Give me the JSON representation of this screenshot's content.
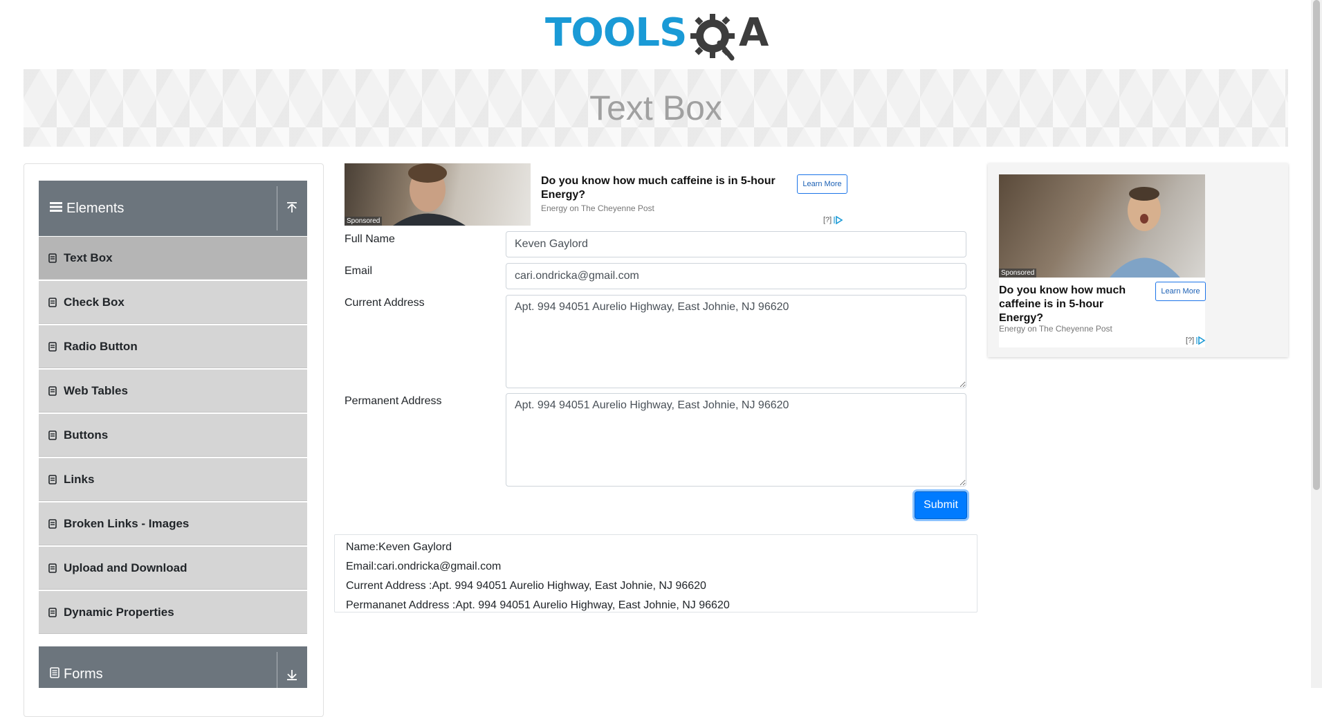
{
  "logo": {
    "text": "TOOLS",
    "suffix": "A"
  },
  "page_title": "Text Box",
  "nav": {
    "elements_group": {
      "label": "Elements",
      "icon": "hamburger-icon",
      "toggle_icon": "collapse-up-icon"
    },
    "items": [
      {
        "label": "Text Box",
        "active": true
      },
      {
        "label": "Check Box"
      },
      {
        "label": "Radio Button"
      },
      {
        "label": "Web Tables"
      },
      {
        "label": "Buttons"
      },
      {
        "label": "Links"
      },
      {
        "label": "Broken Links - Images"
      },
      {
        "label": "Upload and Download"
      },
      {
        "label": "Dynamic Properties"
      }
    ],
    "forms_group": {
      "label": "Forms",
      "icon": "document-icon",
      "toggle_icon": "expand-down-icon"
    }
  },
  "ad_top": {
    "sponsored": "Sponsored",
    "headline": "Do you know how much caffeine is in 5-hour Energy?",
    "source": "Energy on The Cheyenne Post",
    "cta": "Learn More",
    "adchoices": "[?]"
  },
  "form": {
    "full_name": {
      "label": "Full Name",
      "value": "Keven Gaylord"
    },
    "email": {
      "label": "Email",
      "value": "cari.ondricka@gmail.com"
    },
    "current_address": {
      "label": "Current Address",
      "value": "Apt. 994 94051 Aurelio Highway, East Johnie, NJ 96620"
    },
    "permanent_address": {
      "label": "Permanent Address",
      "value": "Apt. 994 94051 Aurelio Highway, East Johnie, NJ 96620"
    },
    "submit_label": "Submit"
  },
  "output": {
    "name": "Name:Keven Gaylord",
    "email": "Email:cari.ondricka@gmail.com",
    "current_address": "Current Address :Apt. 994 94051 Aurelio Highway, East Johnie, NJ 96620",
    "permanent_address": "Permananet Address :Apt. 994 94051 Aurelio Highway, East Johnie, NJ 96620"
  },
  "ad_right": {
    "sponsored": "Sponsored",
    "headline": "Do you know how much caffeine is in 5-hour Energy?",
    "source": "Energy on The Cheyenne Post",
    "cta": "Learn More",
    "adchoices": "[?]"
  },
  "colors": {
    "brand_blue": "#1a9ad6",
    "nav_header": "#6c757d",
    "nav_item": "#d5d5d5",
    "nav_item_active": "#b5b5b5",
    "submit": "#007bff"
  }
}
